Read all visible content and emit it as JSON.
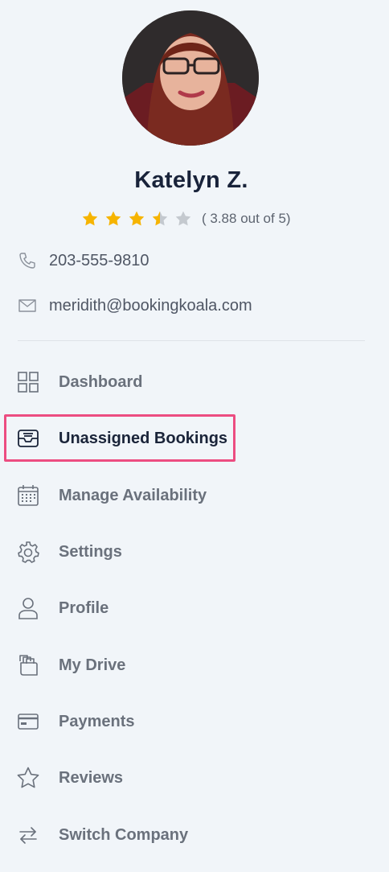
{
  "profile": {
    "avatar_icon": "avatar",
    "name": "Katelyn Z.",
    "rating_value": 3.88,
    "rating_max": 5,
    "rating_text": "( 3.88 out of 5)",
    "star_color": "#f6b400",
    "star_empty_color": "#c4c9cf"
  },
  "contact": {
    "phone_icon": "phone-icon",
    "phone": "203-555-9810",
    "email_icon": "envelope-icon",
    "email": "meridith@bookingkoala.com"
  },
  "nav": {
    "items": [
      {
        "label": "Dashboard",
        "icon": "grid-icon",
        "active": false
      },
      {
        "label": "Unassigned Bookings",
        "icon": "inbox-icon",
        "active": true
      },
      {
        "label": "Manage Availability",
        "icon": "calendar-icon",
        "active": false
      },
      {
        "label": "Settings",
        "icon": "gear-icon",
        "active": false
      },
      {
        "label": "Profile",
        "icon": "user-icon",
        "active": false
      },
      {
        "label": "My Drive",
        "icon": "documents-icon",
        "active": false
      },
      {
        "label": "Payments",
        "icon": "credit-card-icon",
        "active": false
      },
      {
        "label": "Reviews",
        "icon": "star-outline-icon",
        "active": false
      },
      {
        "label": "Switch Company",
        "icon": "swap-arrows-icon",
        "active": false
      }
    ],
    "highlight_color": "#ec4d81"
  }
}
